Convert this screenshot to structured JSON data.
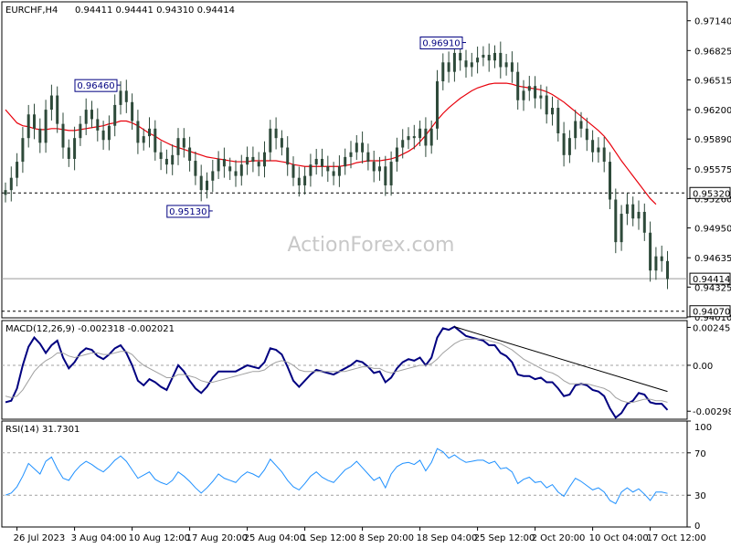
{
  "chart_data": [
    {
      "panel": "price",
      "type": "candlestick",
      "title": "EURCHF,H4",
      "ohlc_header": "0.94411 0.94441 0.94310 0.94414",
      "ylim": [
        0.94,
        0.9734
      ],
      "y_ticks": [
        "0.97140",
        "0.96825",
        "0.96515",
        "0.96200",
        "0.95890",
        "0.95575",
        "0.95260",
        "0.94950",
        "0.94635",
        "0.94325",
        "0.94010"
      ],
      "watermark": "ActionForex.com",
      "annotations": [
        {
          "label": "0.96460",
          "bar": 20,
          "value": 0.9646
        },
        {
          "label": "0.95130",
          "bar": 36,
          "value": 0.9513
        },
        {
          "label": "0.96910",
          "bar": 80,
          "value": 0.9691
        }
      ],
      "hlines": [
        {
          "label": "0.95320",
          "value": 0.9532,
          "style": "dashed"
        },
        {
          "label": "0.94414",
          "value": 0.94414,
          "style": "solid"
        },
        {
          "label": "0.94070",
          "value": 0.9407,
          "style": "dashed"
        }
      ],
      "ma_color": "#e8000b",
      "candle_color": "#2e4a3a",
      "closes": [
        0.9535,
        0.9548,
        0.9565,
        0.959,
        0.9615,
        0.96,
        0.9585,
        0.962,
        0.9635,
        0.9605,
        0.958,
        0.9568,
        0.959,
        0.9605,
        0.962,
        0.961,
        0.9598,
        0.9588,
        0.9603,
        0.9625,
        0.964,
        0.9628,
        0.9608,
        0.9585,
        0.9592,
        0.96,
        0.9575,
        0.9568,
        0.9562,
        0.9572,
        0.959,
        0.958,
        0.9566,
        0.955,
        0.9535,
        0.9545,
        0.9555,
        0.9568,
        0.956,
        0.9555,
        0.955,
        0.9562,
        0.957,
        0.9565,
        0.956,
        0.9575,
        0.96,
        0.959,
        0.958,
        0.9562,
        0.9548,
        0.954,
        0.955,
        0.9562,
        0.9568,
        0.956,
        0.9555,
        0.955,
        0.956,
        0.957,
        0.9575,
        0.9585,
        0.9575,
        0.9565,
        0.9555,
        0.956,
        0.954,
        0.9565,
        0.958,
        0.9588,
        0.9592,
        0.959,
        0.96,
        0.9582,
        0.96,
        0.965,
        0.967,
        0.966,
        0.968,
        0.9672,
        0.9665,
        0.967,
        0.9675,
        0.9678,
        0.9672,
        0.968,
        0.9665,
        0.967,
        0.966,
        0.963,
        0.964,
        0.9645,
        0.9632,
        0.9635,
        0.9615,
        0.9622,
        0.9595,
        0.9572,
        0.959,
        0.9608,
        0.96,
        0.9588,
        0.9575,
        0.958,
        0.9565,
        0.9525,
        0.948,
        0.951,
        0.952,
        0.9505,
        0.9512,
        0.949,
        0.945,
        0.9465,
        0.946,
        0.9441
      ],
      "ma": [
        0.962,
        0.9613,
        0.9606,
        0.9603,
        0.9602,
        0.96,
        0.9599,
        0.9599,
        0.96,
        0.96,
        0.9599,
        0.9598,
        0.9598,
        0.9599,
        0.96,
        0.9601,
        0.9602,
        0.9603,
        0.9605,
        0.9606,
        0.9608,
        0.9608,
        0.9606,
        0.9603,
        0.9599,
        0.9595,
        0.9592,
        0.9588,
        0.9585,
        0.9582,
        0.958,
        0.9578,
        0.9576,
        0.9574,
        0.9572,
        0.957,
        0.9569,
        0.9568,
        0.9567,
        0.9566,
        0.9565,
        0.9565,
        0.9565,
        0.9566,
        0.9566,
        0.9566,
        0.9566,
        0.9566,
        0.9565,
        0.9564,
        0.9562,
        0.9561,
        0.956,
        0.956,
        0.956,
        0.956,
        0.956,
        0.956,
        0.956,
        0.9561,
        0.9562,
        0.9564,
        0.9565,
        0.9566,
        0.9566,
        0.9566,
        0.9567,
        0.9568,
        0.957,
        0.9573,
        0.9576,
        0.958,
        0.9586,
        0.9593,
        0.9601,
        0.9609,
        0.9616,
        0.9622,
        0.9627,
        0.9632,
        0.9636,
        0.964,
        0.9643,
        0.9645,
        0.9647,
        0.9648,
        0.9648,
        0.9648,
        0.9647,
        0.9645,
        0.9644,
        0.9643,
        0.9642,
        0.9641,
        0.9639,
        0.9636,
        0.9632,
        0.9628,
        0.9623,
        0.9618,
        0.9613,
        0.9608,
        0.9603,
        0.9598,
        0.9592,
        0.9584,
        0.9575,
        0.9566,
        0.9558,
        0.955,
        0.9542,
        0.9534,
        0.9526,
        0.952
      ]
    },
    {
      "panel": "macd",
      "type": "line",
      "title": "MACD(12,26,9) -0.002318 -0.002021",
      "ylim": [
        -0.0035,
        0.0029
      ],
      "y_ticks": [
        "0.002459",
        "0.00",
        "-0.00298"
      ],
      "series": [
        {
          "role": "macd",
          "color": "#000080",
          "values": [
            -0.0024,
            -0.0023,
            -0.0015,
            0.0,
            0.0012,
            0.0018,
            0.0014,
            0.0008,
            0.0013,
            0.0016,
            0.0005,
            -0.0002,
            0.0002,
            0.0008,
            0.0011,
            0.001,
            0.0006,
            0.0004,
            0.0007,
            0.0011,
            0.0013,
            0.0008,
            0.0,
            -0.001,
            -0.0013,
            -0.0009,
            -0.0011,
            -0.0014,
            -0.0016,
            -0.0008,
            0.0,
            -0.0004,
            -0.001,
            -0.0015,
            -0.0018,
            -0.0014,
            -0.0008,
            -0.0004,
            -0.0004,
            -0.0004,
            -0.0004,
            -0.0002,
            0.0,
            -0.0001,
            -0.0002,
            0.0002,
            0.0011,
            0.001,
            0.0007,
            -0.0001,
            -0.001,
            -0.0014,
            -0.001,
            -0.0006,
            -0.0003,
            -0.0004,
            -0.0005,
            -0.0006,
            -0.0004,
            -0.0002,
            0.0,
            0.0003,
            0.0002,
            -0.0001,
            -0.0005,
            -0.0004,
            -0.0011,
            -0.0008,
            -0.0002,
            0.0002,
            0.0004,
            0.0003,
            0.0005,
            0.0,
            0.0005,
            0.0018,
            0.0024,
            0.0023,
            0.0025,
            0.0022,
            0.0019,
            0.0018,
            0.0017,
            0.0016,
            0.0013,
            0.0013,
            0.0008,
            0.0006,
            0.0002,
            -0.0006,
            -0.0007,
            -0.0007,
            -0.0009,
            -0.0008,
            -0.0011,
            -0.0011,
            -0.0015,
            -0.002,
            -0.0019,
            -0.0013,
            -0.0012,
            -0.0013,
            -0.0016,
            -0.0017,
            -0.002,
            -0.0028,
            -0.0034,
            -0.0031,
            -0.0025,
            -0.0023,
            -0.0018,
            -0.0019,
            -0.0024,
            -0.0025,
            -0.0025,
            -0.0029
          ]
        },
        {
          "role": "signal",
          "color": "#a0a0a0",
          "values": [
            -0.002,
            -0.0021,
            -0.002,
            -0.0016,
            -0.001,
            -0.0004,
            0.0,
            0.0003,
            0.0005,
            0.0008,
            0.0008,
            0.0006,
            0.0005,
            0.0006,
            0.0007,
            0.0008,
            0.0008,
            0.0007,
            0.0007,
            0.0008,
            0.0009,
            0.0009,
            0.0007,
            0.0003,
            0.0,
            -0.0002,
            -0.0004,
            -0.0006,
            -0.0008,
            -0.0008,
            -0.0006,
            -0.0006,
            -0.0007,
            -0.0008,
            -0.001,
            -0.0011,
            -0.0011,
            -0.001,
            -0.0009,
            -0.0008,
            -0.0007,
            -0.0006,
            -0.0005,
            -0.0004,
            -0.0004,
            -0.0003,
            0.0,
            0.0002,
            0.0003,
            0.0002,
            0.0,
            -0.0003,
            -0.0004,
            -0.0004,
            -0.0004,
            -0.0004,
            -0.0004,
            -0.0004,
            -0.0004,
            -0.0004,
            -0.0003,
            -0.0002,
            -0.0001,
            -0.0001,
            -0.0002,
            -0.0002,
            -0.0004,
            -0.0005,
            -0.0004,
            -0.0003,
            -0.0002,
            -0.0001,
            0.0,
            0.0,
            0.0001,
            0.0004,
            0.0008,
            0.0011,
            0.0014,
            0.0016,
            0.0017,
            0.0017,
            0.0017,
            0.0017,
            0.0016,
            0.0015,
            0.0014,
            0.0012,
            0.001,
            0.0007,
            0.0004,
            0.0002,
            0.0,
            -0.0002,
            -0.0004,
            -0.0005,
            -0.0007,
            -0.001,
            -0.0012,
            -0.0012,
            -0.0012,
            -0.0012,
            -0.0013,
            -0.0014,
            -0.0015,
            -0.0017,
            -0.0021,
            -0.0023,
            -0.0024,
            -0.0024,
            -0.0023,
            -0.0022,
            -0.0022,
            -0.0023,
            -0.0023,
            -0.0024
          ]
        }
      ],
      "trendline": {
        "from": {
          "bar": 78,
          "value": 0.0025
        },
        "to": {
          "bar": 115,
          "value": -0.0017
        }
      }
    },
    {
      "panel": "rsi",
      "type": "line",
      "title": "RSI(14) 31.7301",
      "ylim": [
        0,
        100
      ],
      "y_ticks": [
        "100",
        "70",
        "30",
        "0"
      ],
      "levels": [
        70,
        30
      ],
      "series": [
        {
          "role": "rsi",
          "color": "#1e90ff",
          "values": [
            30,
            32,
            38,
            48,
            60,
            55,
            50,
            62,
            66,
            55,
            46,
            44,
            52,
            58,
            62,
            59,
            55,
            52,
            57,
            63,
            67,
            62,
            54,
            46,
            49,
            52,
            45,
            42,
            40,
            44,
            52,
            48,
            43,
            37,
            32,
            37,
            43,
            50,
            46,
            44,
            42,
            48,
            52,
            50,
            47,
            54,
            64,
            58,
            52,
            44,
            38,
            35,
            41,
            48,
            52,
            47,
            44,
            42,
            48,
            54,
            57,
            62,
            56,
            50,
            44,
            47,
            37,
            50,
            57,
            60,
            61,
            59,
            63,
            53,
            61,
            74,
            71,
            65,
            68,
            64,
            61,
            62,
            63,
            63,
            60,
            62,
            55,
            56,
            52,
            41,
            45,
            47,
            42,
            43,
            37,
            40,
            33,
            29,
            38,
            46,
            43,
            39,
            35,
            37,
            33,
            25,
            22,
            33,
            37,
            33,
            36,
            31,
            25,
            33,
            33,
            31.73
          ]
        }
      ]
    }
  ],
  "x_axis_labels": [
    {
      "label": "26 Jul 2023",
      "bar": 2
    },
    {
      "label": "3 Aug 04:00",
      "bar": 12
    },
    {
      "label": "10 Aug 12:00",
      "bar": 22
    },
    {
      "label": "17 Aug 20:00",
      "bar": 32
    },
    {
      "label": "25 Aug 04:00",
      "bar": 42
    },
    {
      "label": "1 Sep 12:00",
      "bar": 52
    },
    {
      "label": "8 Sep 20:00",
      "bar": 62
    },
    {
      "label": "18 Sep 04:00",
      "bar": 72
    },
    {
      "label": "25 Sep 12:00",
      "bar": 82
    },
    {
      "label": "2 Oct 20:00",
      "bar": 92
    },
    {
      "label": "10 Oct 04:00",
      "bar": 102
    },
    {
      "label": "17 Oct 12:00",
      "bar": 112
    }
  ]
}
